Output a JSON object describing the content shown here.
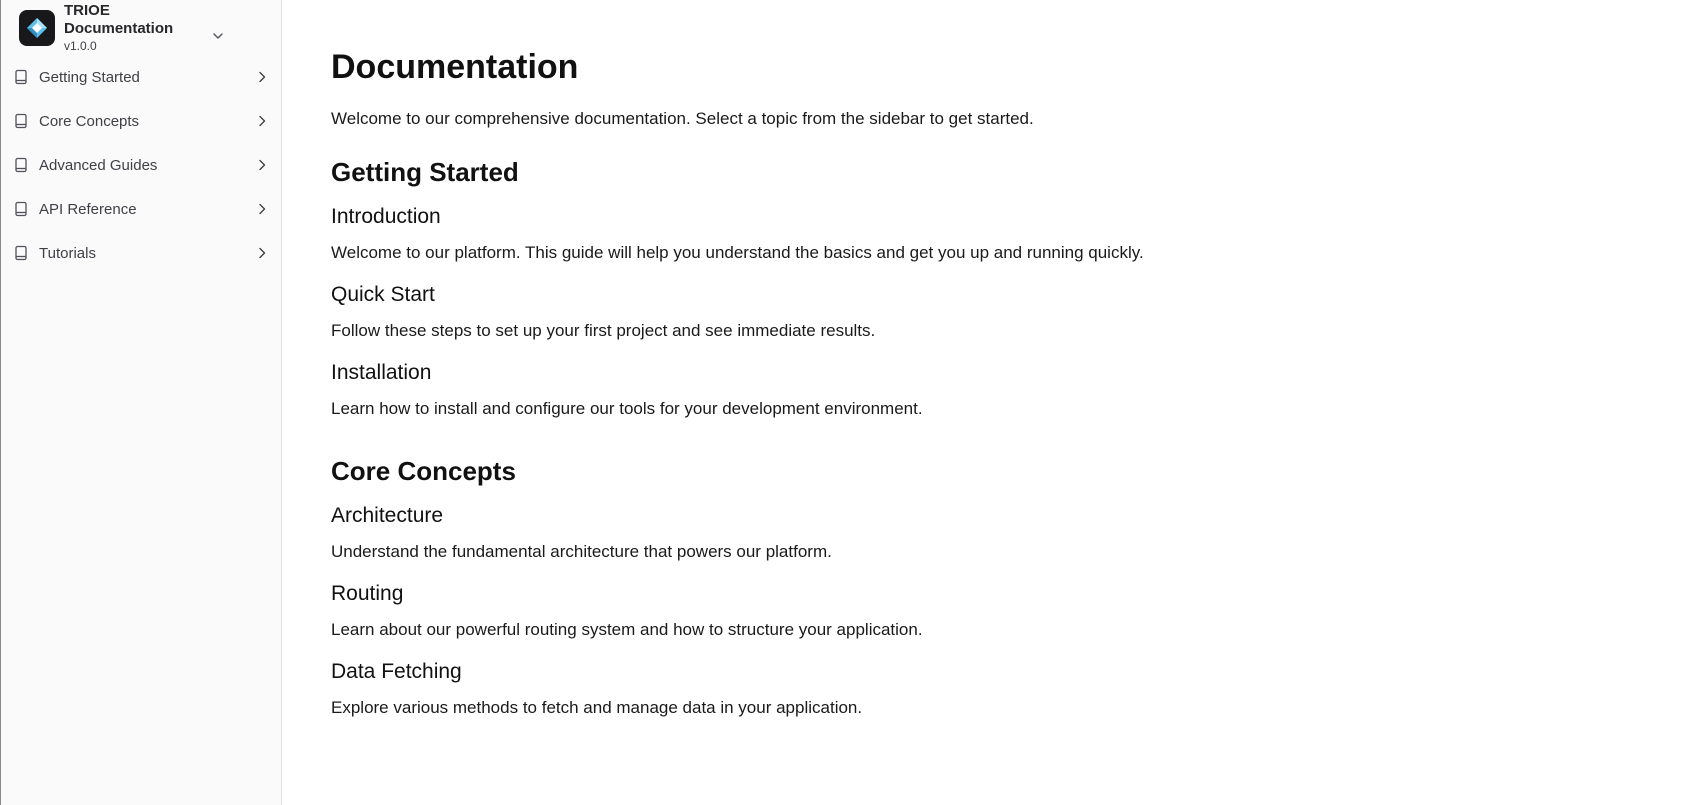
{
  "brand": {
    "title": "TRIOE Documentation",
    "version": "v1.0.0",
    "logo_icon": "diamond-logo-icon",
    "logo_bg": "#18181b"
  },
  "sidebar": {
    "items": [
      {
        "label": "Getting Started",
        "icon": "book-icon"
      },
      {
        "label": "Core Concepts",
        "icon": "book-icon"
      },
      {
        "label": "Advanced Guides",
        "icon": "book-icon"
      },
      {
        "label": "API Reference",
        "icon": "book-icon"
      },
      {
        "label": "Tutorials",
        "icon": "book-icon"
      }
    ]
  },
  "main": {
    "title": "Documentation",
    "intro": "Welcome to our comprehensive documentation. Select a topic from the sidebar to get started.",
    "sections": [
      {
        "heading": "Getting Started",
        "topics": [
          {
            "title": "Introduction",
            "text": "Welcome to our platform. This guide will help you understand the basics and get you up and running quickly."
          },
          {
            "title": "Quick Start",
            "text": "Follow these steps to set up your first project and see immediate results."
          },
          {
            "title": "Installation",
            "text": "Learn how to install and configure our tools for your development environment."
          }
        ]
      },
      {
        "heading": "Core Concepts",
        "topics": [
          {
            "title": "Architecture",
            "text": "Understand the fundamental architecture that powers our platform."
          },
          {
            "title": "Routing",
            "text": "Learn about our powerful routing system and how to structure your application."
          },
          {
            "title": "Data Fetching",
            "text": "Explore various methods to fetch and manage data in your application."
          }
        ]
      }
    ]
  }
}
